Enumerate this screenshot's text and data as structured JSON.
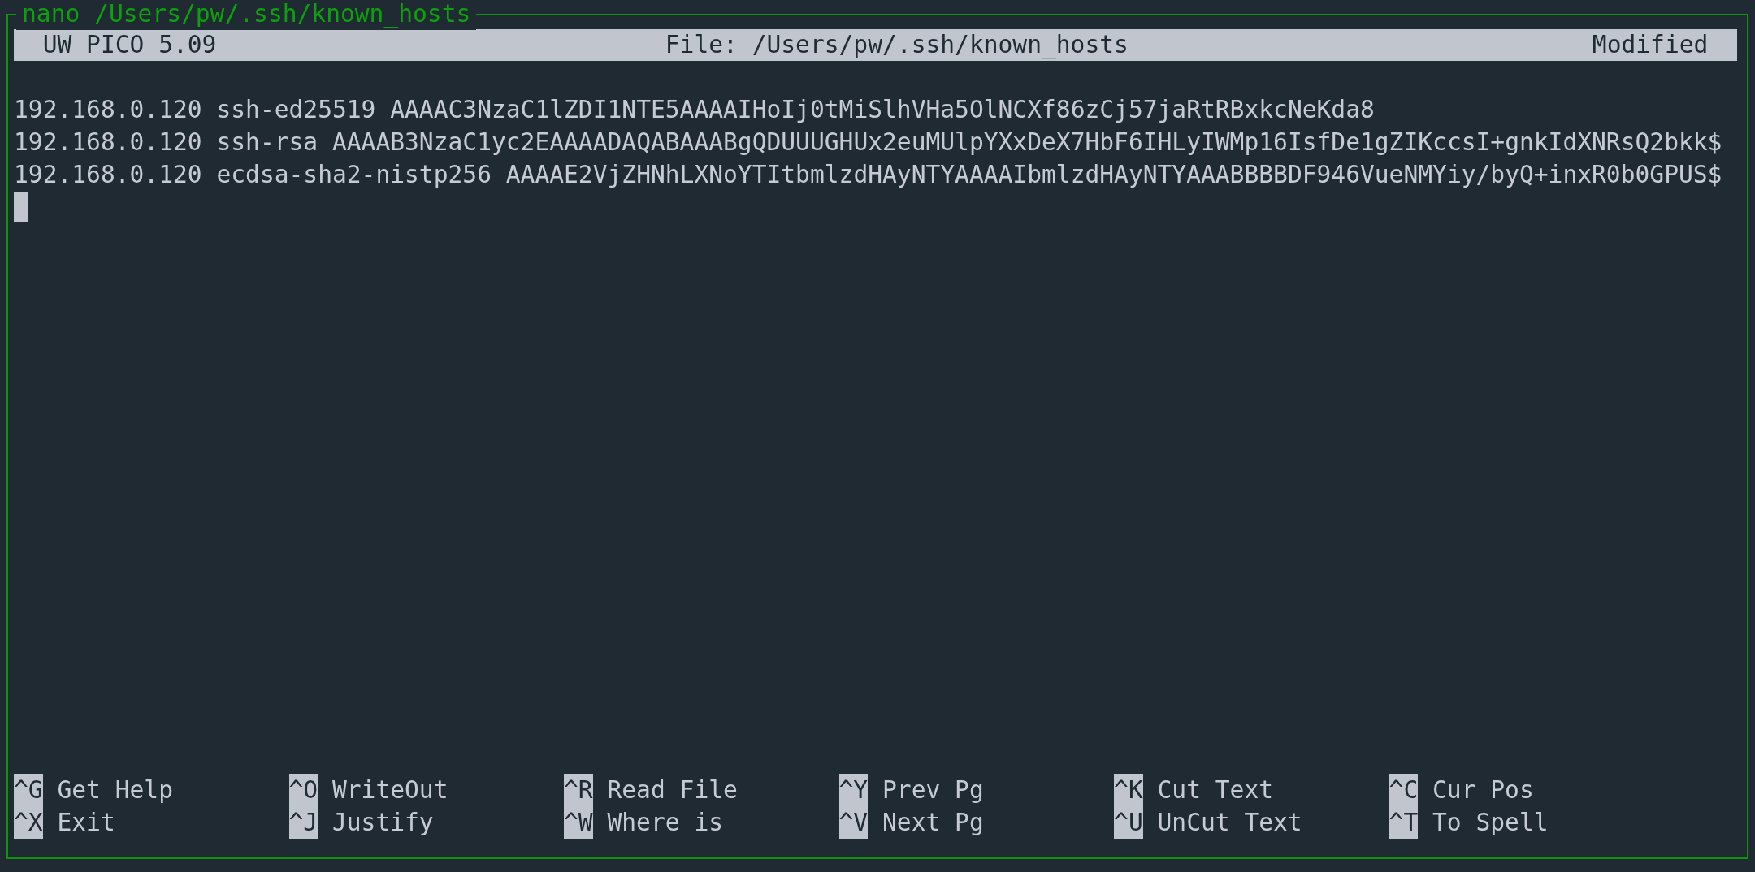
{
  "window": {
    "title": "nano /Users/pw/.ssh/known_hosts"
  },
  "header": {
    "app": "UW PICO 5.09",
    "file": "File: /Users/pw/.ssh/known_hosts",
    "status": "Modified"
  },
  "lines": [
    "192.168.0.120 ssh-ed25519 AAAAC3NzaC1lZDI1NTE5AAAAIHoIj0tMiSlhVHa5OlNCXf86zCj57jaRtRBxkcNeKda8",
    "192.168.0.120 ssh-rsa AAAAB3NzaC1yc2EAAAADAQABAAABgQDUUUGHUx2euMUlpYXxDeX7HbF6IHLyIWMp16IsfDe1gZIKccsI+gnkIdXNRsQ2bkk$",
    "192.168.0.120 ecdsa-sha2-nistp256 AAAAE2VjZHNhLXNoYTItbmlzdHAyNTYAAAAIbmlzdHAyNTYAAABBBBDF946VueNMYiy/byQ+inxR0b0GPUS$"
  ],
  "shortcuts": [
    {
      "key": "^G",
      "label": "Get Help"
    },
    {
      "key": "^O",
      "label": "WriteOut"
    },
    {
      "key": "^R",
      "label": "Read File"
    },
    {
      "key": "^Y",
      "label": "Prev Pg"
    },
    {
      "key": "^K",
      "label": "Cut Text"
    },
    {
      "key": "^C",
      "label": "Cur Pos"
    },
    {
      "key": "^X",
      "label": "Exit"
    },
    {
      "key": "^J",
      "label": "Justify"
    },
    {
      "key": "^W",
      "label": "Where is"
    },
    {
      "key": "^V",
      "label": "Next Pg"
    },
    {
      "key": "^U",
      "label": "UnCut Text"
    },
    {
      "key": "^T",
      "label": "To Spell"
    }
  ]
}
